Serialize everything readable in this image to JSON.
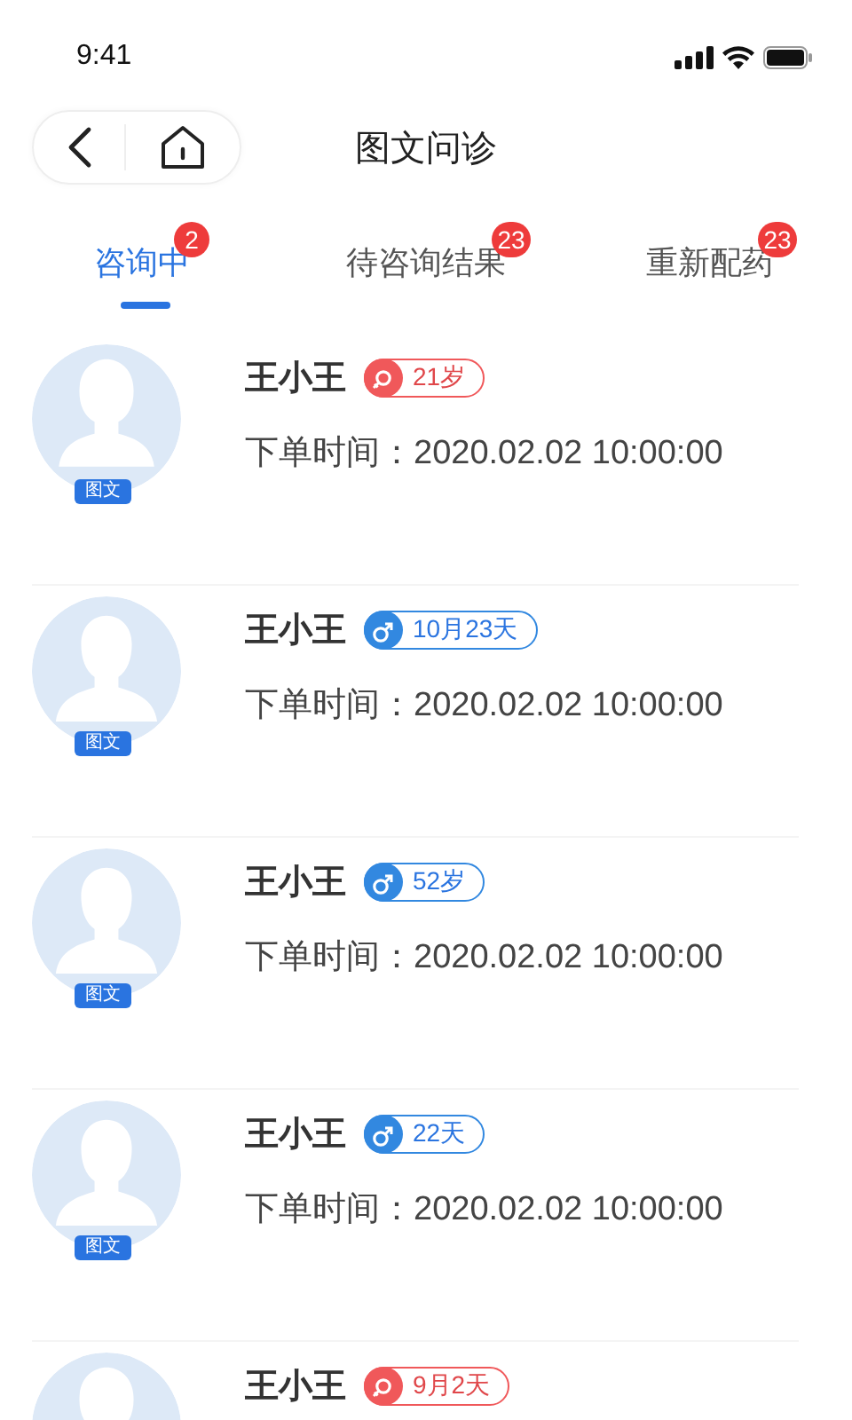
{
  "status_bar": {
    "time": "9:41"
  },
  "nav": {
    "title": "图文问诊"
  },
  "tabs": [
    {
      "label": "咨询中",
      "badge": "2",
      "selected": true
    },
    {
      "label": "待咨询结果",
      "badge": "23",
      "selected": false
    },
    {
      "label": "重新配药",
      "badge": "23",
      "selected": false
    }
  ],
  "orders": [
    {
      "name": "王小王",
      "kind": "female",
      "age": "21岁",
      "avatar_tag": "图文",
      "time": "下单时间：2020.02.02 10:00:00"
    },
    {
      "name": "王小王",
      "kind": "male",
      "age": "10月23天",
      "avatar_tag": "图文",
      "time": "下单时间：2020.02.02 10:00:00"
    },
    {
      "name": "王小王",
      "kind": "male",
      "age": "52岁",
      "avatar_tag": "图文",
      "time": "下单时间：2020.02.02 10:00:00"
    },
    {
      "name": "王小王",
      "kind": "male",
      "age": "22天",
      "avatar_tag": "图文",
      "time": "下单时间：2020.02.02 10:00:00"
    },
    {
      "name": "王小王",
      "kind": "female",
      "age": "9月2天"
    }
  ]
}
